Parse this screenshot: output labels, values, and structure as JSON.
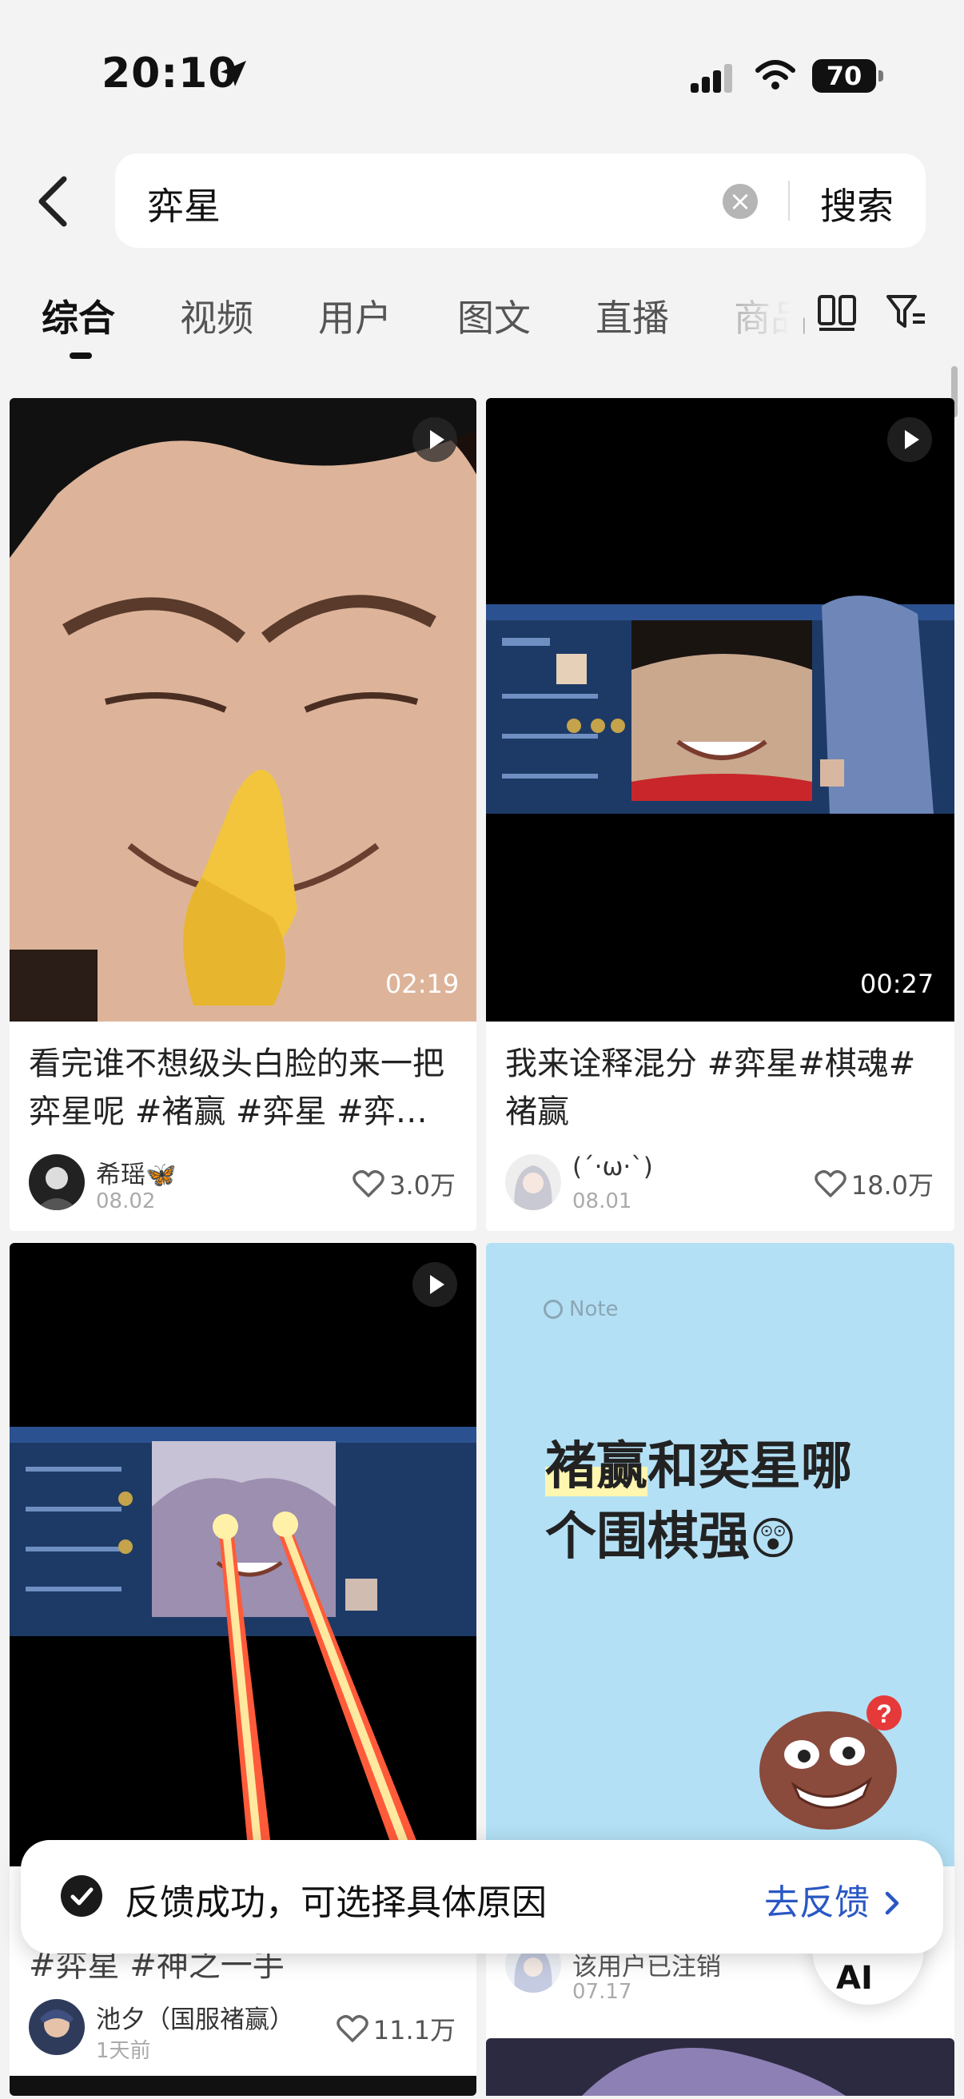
{
  "status_bar": {
    "time": "20:10",
    "battery": "70"
  },
  "search": {
    "query": "弈星",
    "submit_label": "搜索"
  },
  "tabs": [
    {
      "label": "综合",
      "active": true
    },
    {
      "label": "视频"
    },
    {
      "label": "用户"
    },
    {
      "label": "图文"
    },
    {
      "label": "直播"
    },
    {
      "label": "商品"
    }
  ],
  "cards": [
    {
      "title": "看完谁不想级头白脸的来一把弈星呢 #褚赢 #弈星 #弈…",
      "duration": "02:19",
      "author": "希瑶🦋",
      "date": "08.02",
      "likes": "3.0万"
    },
    {
      "title": "我来诠释混分 #弈星#棋魂#褚赢",
      "duration": "00:27",
      "author": "(ˊ·ω·ˋ)",
      "date": "08.01",
      "likes": "18.0万"
    },
    {
      "title_partial": "#弈星 #神之一手",
      "author": "池夕（国服褚赢）",
      "date": "1天前",
      "likes": "11.1万"
    },
    {
      "note_label": "Note",
      "note_highlight": "褚赢",
      "note_rest_line1": "和奕星哪",
      "note_line2": "个围棋强",
      "author": "该用户已注销",
      "date": "07.17"
    }
  ],
  "toast": {
    "message": "反馈成功，可选择具体原因",
    "action": "去反馈"
  },
  "ai_button": {
    "label": "AI"
  },
  "colors": {
    "accent": "#2a57c4",
    "note_bg": "#b3e0f5",
    "highlight": "#fff6b0"
  }
}
